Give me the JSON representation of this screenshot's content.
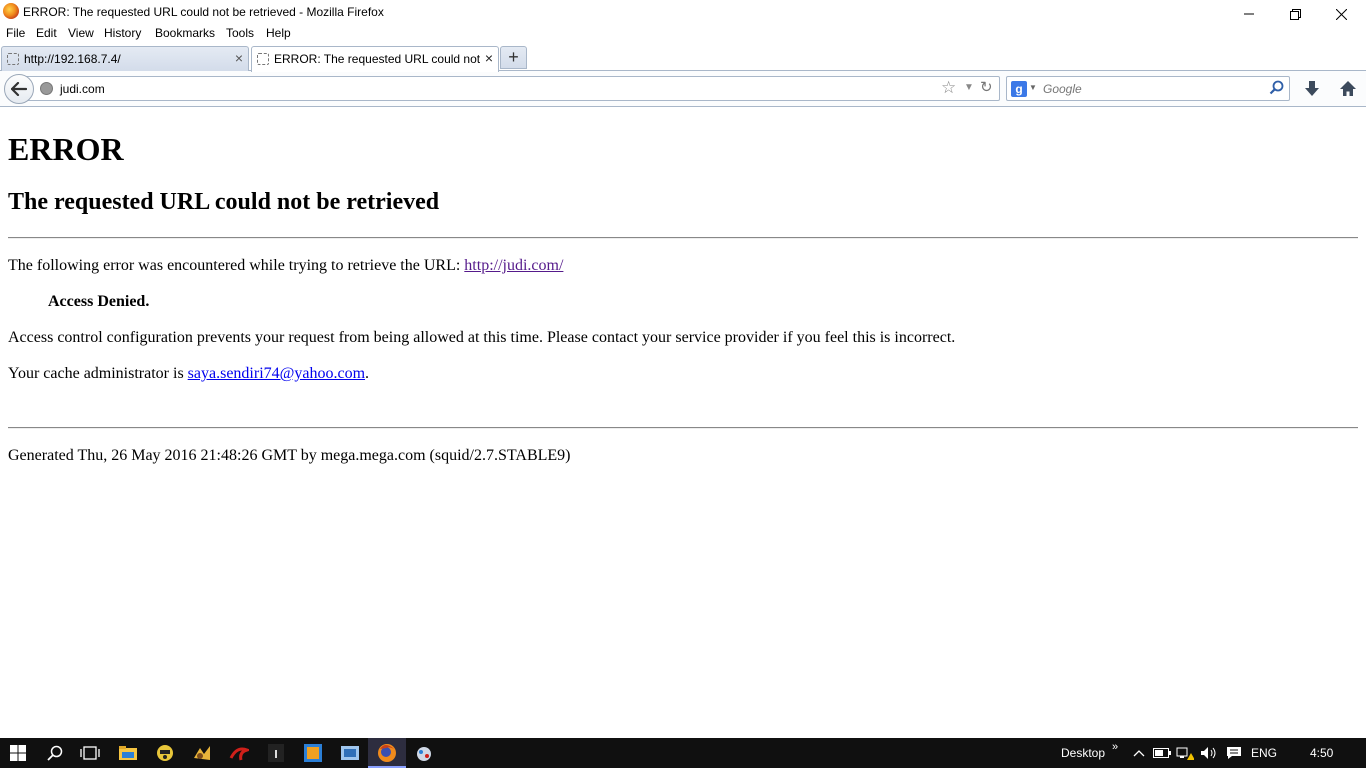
{
  "window": {
    "title": "ERROR: The requested URL could not be retrieved - Mozilla Firefox"
  },
  "menubar": {
    "items": [
      {
        "label": "File"
      },
      {
        "label": "Edit"
      },
      {
        "label": "View"
      },
      {
        "label": "History"
      },
      {
        "label": "Bookmarks"
      },
      {
        "label": "Tools"
      },
      {
        "label": "Help"
      }
    ]
  },
  "tabs": [
    {
      "label": "http://192.168.7.4/",
      "active": false
    },
    {
      "label": "ERROR: The requested URL could not ...",
      "active": true
    }
  ],
  "newtab_label": "+",
  "navbar": {
    "url": "judi.com",
    "search_engine": "Google",
    "search_placeholder": "Google"
  },
  "page": {
    "h1": "ERROR",
    "h2": "The requested URL could not be retrieved",
    "intro": "The following error was encountered while trying to retrieve the URL: ",
    "intro_link": "http://judi.com/",
    "denied": "Access Denied.",
    "explanation": "Access control configuration prevents your request from being allowed at this time. Please contact your service provider if you feel this is incorrect.",
    "cache_prefix": "Your cache administrator is ",
    "cache_email": "saya.sendiri74@yahoo.com",
    "cache_suffix": ".",
    "footer": "Generated Thu, 26 May 2016 21:48:26 GMT by mega.mega.com (squid/2.7.STABLE9)"
  },
  "taskbar": {
    "desktop_label": "Desktop",
    "language": "ENG",
    "time": "4:50"
  },
  "colors": {
    "link": "#0000ee",
    "visited_link": "#551a8b",
    "taskbar_bg": "#101010",
    "chrome_border": "#a9b7c9"
  }
}
